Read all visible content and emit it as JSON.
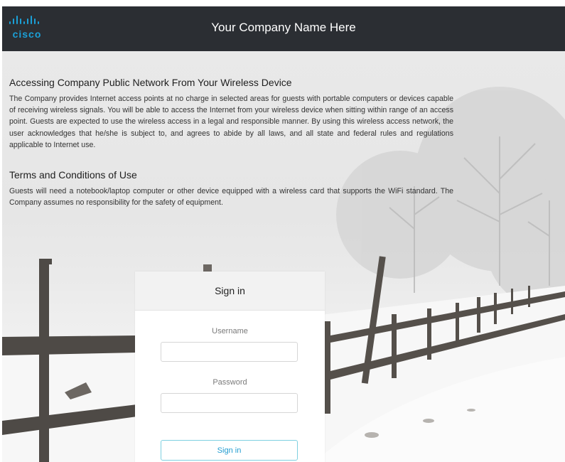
{
  "header": {
    "logo_text": "cisco",
    "title": "Your Company Name Here"
  },
  "sections": [
    {
      "heading": "Accessing Company Public Network From Your Wireless Device",
      "body": "The Company provides Internet access points at no charge in selected areas for guests with portable computers or devices capable of receiving wireless signals. You will be able to access the Internet from your wireless device when sitting within range of an access point. Guests are expected to use the wireless access in a legal and responsible manner. By using this wireless access network, the user acknowledges that he/she is subject to, and agrees to abide by all laws, and all state and federal rules and regulations applicable to Internet use."
    },
    {
      "heading": "Terms and Conditions of Use",
      "body": "Guests will need a notebook/laptop computer or other device equipped with a wireless card that supports the WiFi standard. The Company assumes no responsibility for the safety of equipment."
    }
  ],
  "signin": {
    "title": "Sign in",
    "username_label": "Username",
    "username_value": "",
    "password_label": "Password",
    "password_value": "",
    "button_label": "Sign in"
  },
  "colors": {
    "header_bg": "#2b2e33",
    "logo": "#1ba0d7",
    "button_border": "#7ed0e0",
    "button_text": "#1f9bd0"
  }
}
